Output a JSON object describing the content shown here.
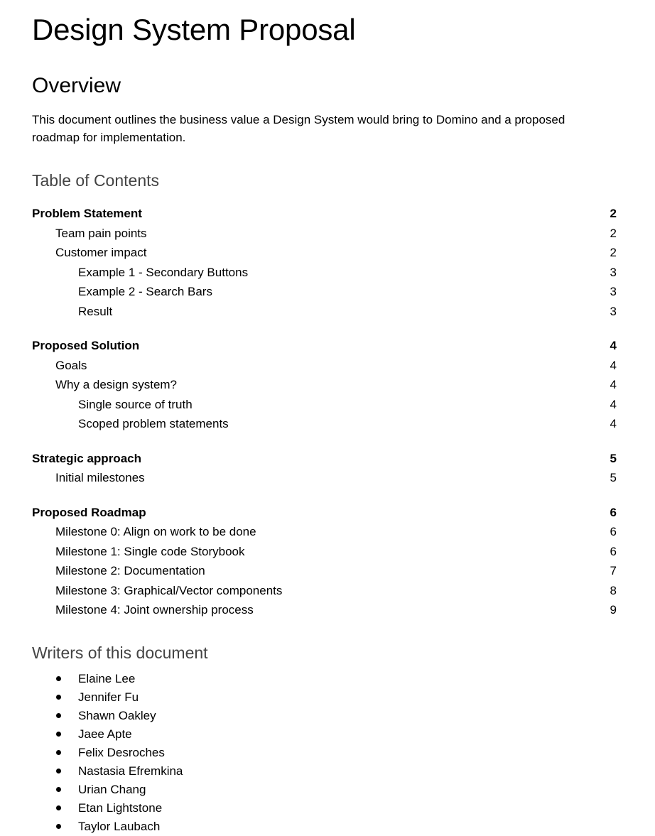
{
  "document": {
    "title": "Design System Proposal",
    "overview_heading": "Overview",
    "overview_paragraph": "This document outlines the business value a Design System would bring to Domino and a proposed roadmap for implementation.",
    "toc_heading": "Table of Contents",
    "writers_heading": "Writers of this document"
  },
  "colors": {
    "text": "#000000",
    "heading_gray": "#434343",
    "background": "#ffffff"
  },
  "toc": {
    "groups": [
      {
        "entries": [
          {
            "label": "Problem Statement",
            "page": "2",
            "level": 1
          },
          {
            "label": "Team pain points",
            "page": "2",
            "level": 2
          },
          {
            "label": "Customer impact",
            "page": "2",
            "level": 2
          },
          {
            "label": "Example 1 - Secondary Buttons",
            "page": "3",
            "level": 3
          },
          {
            "label": "Example 2 - Search Bars",
            "page": "3",
            "level": 3
          },
          {
            "label": "Result",
            "page": "3",
            "level": 3
          }
        ]
      },
      {
        "entries": [
          {
            "label": "Proposed Solution",
            "page": "4",
            "level": 1
          },
          {
            "label": "Goals",
            "page": "4",
            "level": 2
          },
          {
            "label": "Why a design system?",
            "page": "4",
            "level": 2
          },
          {
            "label": "Single source of truth",
            "page": "4",
            "level": 3
          },
          {
            "label": "Scoped problem statements",
            "page": "4",
            "level": 3
          }
        ]
      },
      {
        "entries": [
          {
            "label": "Strategic approach",
            "page": "5",
            "level": 1
          },
          {
            "label": "Initial milestones",
            "page": "5",
            "level": 2
          }
        ]
      },
      {
        "entries": [
          {
            "label": "Proposed Roadmap",
            "page": "6",
            "level": 1
          },
          {
            "label": "Milestone 0: Align on work to be done",
            "page": "6",
            "level": 2
          },
          {
            "label": "Milestone 1: Single code Storybook",
            "page": "6",
            "level": 2
          },
          {
            "label": "Milestone 2: Documentation",
            "page": "7",
            "level": 2
          },
          {
            "label": "Milestone 3: Graphical/Vector components",
            "page": "8",
            "level": 2
          },
          {
            "label": "Milestone 4: Joint ownership process",
            "page": "9",
            "level": 2
          }
        ]
      }
    ]
  },
  "writers": [
    {
      "name": "Elaine Lee"
    },
    {
      "name": "Jennifer Fu"
    },
    {
      "name": "Shawn Oakley"
    },
    {
      "name": "Jaee Apte"
    },
    {
      "name": "Felix Desroches"
    },
    {
      "name": "Nastasia Efremkina"
    },
    {
      "name": "Urian Chang"
    },
    {
      "name": "Etan Lightstone"
    },
    {
      "name": "Taylor Laubach"
    }
  ]
}
